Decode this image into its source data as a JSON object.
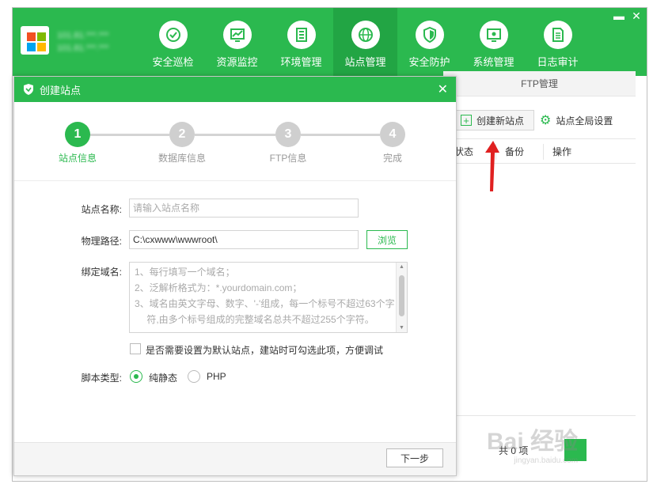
{
  "header": {
    "server_info_line1": "101.81.***.***",
    "server_info_line2": "101.81.***.***",
    "nav": [
      {
        "label": "安全巡检",
        "icon": "shield-scan-icon"
      },
      {
        "label": "资源监控",
        "icon": "monitor-chart-icon"
      },
      {
        "label": "环境管理",
        "icon": "server-rack-icon"
      },
      {
        "label": "站点管理",
        "icon": "globe-icon"
      },
      {
        "label": "安全防护",
        "icon": "shield-icon"
      },
      {
        "label": "系统管理",
        "icon": "settings-screen-icon"
      },
      {
        "label": "日志审计",
        "icon": "document-icon"
      }
    ],
    "active_nav": 3,
    "minimize": "▬",
    "close": "✕"
  },
  "background_panel": {
    "tab_label": "FTP管理",
    "create_site_button": "创建新站点",
    "global_settings": "站点全局设置",
    "columns": [
      "状态",
      "备份",
      "操作"
    ],
    "total_text": "共 0 项"
  },
  "dialog": {
    "title": "创建站点",
    "close": "✕",
    "steps": [
      {
        "number": "1",
        "label": "站点信息"
      },
      {
        "number": "2",
        "label": "数据库信息"
      },
      {
        "number": "3",
        "label": "FTP信息"
      },
      {
        "number": "4",
        "label": "完成"
      }
    ],
    "active_step": 0,
    "site_name_label": "站点名称:",
    "site_name_placeholder": "请输入站点名称",
    "path_label": "物理路径:",
    "path_value": "C:\\cxwww\\wwwroot\\",
    "browse_button": "浏览",
    "domain_label": "绑定域名:",
    "domain_hint_lines": [
      "1、每行填写一个域名；",
      "2、泛解析格式为：*.yourdomain.com；",
      "3、域名由英文字母、数字、'-'组成，每一个标号不超过63个字",
      "　 符,由多个标号组成的完整域名总共不超过255个字符。"
    ],
    "default_site_checkbox": "是否需要设置为默认站点，建站时可勾选此项，方便调试",
    "script_type_label": "脚本类型:",
    "script_options": [
      "纯静态",
      "PHP"
    ],
    "script_selected": "纯静态",
    "next_button": "下一步"
  },
  "watermark": "Bai 经验",
  "watermark_sub": "jingyan.baidu.com",
  "colors": {
    "brand_green": "#2bb94f",
    "active_nav_bg": "#22a544",
    "arrow_red": "#e02020"
  }
}
